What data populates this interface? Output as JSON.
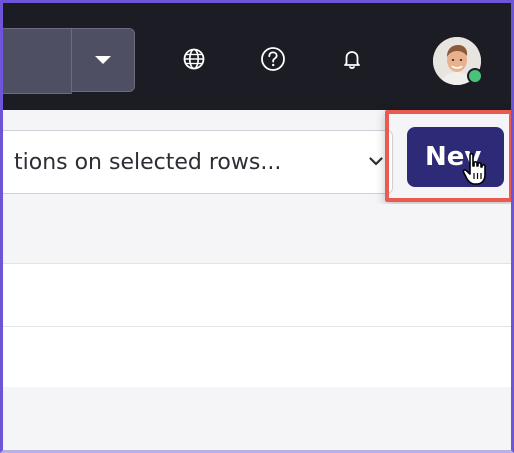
{
  "toolbar": {
    "search_dropdown_icon": "caret-down-icon",
    "language_icon": "globe-icon",
    "help_icon": "question-circle-icon",
    "notifications_icon": "bell-icon",
    "user_status": "online"
  },
  "action_bar": {
    "bulk_actions_placeholder": "tions on selected rows...",
    "new_button_label": "Nev"
  },
  "colors": {
    "topbar_bg": "#1c1d24",
    "primary_button": "#2d2a77",
    "highlight_box": "#ea5a50",
    "online_dot": "#4ac27a"
  }
}
